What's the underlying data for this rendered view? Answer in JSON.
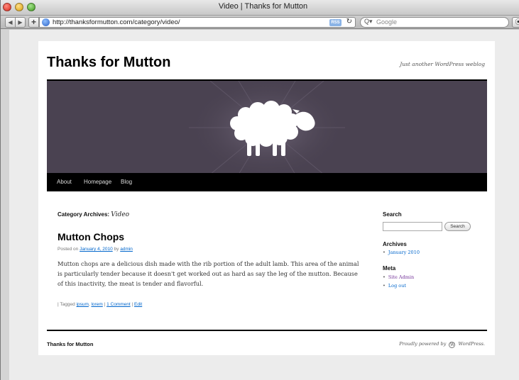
{
  "window": {
    "title": "Video | Thanks for Mutton"
  },
  "toolbar": {
    "url": "http://thanksformutton.com/category/video/",
    "rss_label": "RSS",
    "reload_icon": "reload-icon",
    "search_placeholder": "Google",
    "search_prefix": "Q▾"
  },
  "site": {
    "title": "Thanks for Mutton",
    "tagline": "Just another WordPress weblog"
  },
  "menu": {
    "items": [
      {
        "label": "About"
      },
      {
        "label": "Homepage"
      },
      {
        "label": "Blog"
      }
    ]
  },
  "archive": {
    "prefix": "Category Archives:",
    "name": "Video"
  },
  "post": {
    "title": "Mutton Chops",
    "posted_on": "Posted on",
    "date": "January 4, 2010",
    "by": "by",
    "author": "admin",
    "body": "Mutton chops are a delicious dish made with the rib portion of the adult lamb. This area of the animal is particularly tender because it doesn't get worked out as hard as say the leg of the mutton. Because of this inactivity, the meat is tender and flavorful.",
    "tagged": "| Tagged",
    "tag1": "ipsum",
    "tag2": "lorem",
    "sep": "|",
    "comments": "1 Comment",
    "edit": "Edit"
  },
  "sidebar": {
    "search_heading": "Search",
    "search_button": "Search",
    "archives_heading": "Archives",
    "archives": [
      {
        "label": "January 2010"
      }
    ],
    "meta_heading": "Meta",
    "meta": [
      {
        "label": "Site Admin"
      },
      {
        "label": "Log out"
      }
    ]
  },
  "footer": {
    "title": "Thanks for Mutton",
    "powered_prefix": "Proudly powered by",
    "powered_name": "WordPress."
  },
  "colors": {
    "banner": "#4a4251",
    "link": "#0066cc",
    "visited": "#743399"
  }
}
